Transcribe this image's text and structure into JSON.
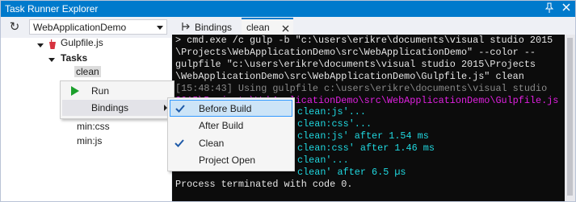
{
  "window": {
    "title": "Task Runner Explorer",
    "accent": "#007acc",
    "controls": [
      "pin",
      "close"
    ]
  },
  "toolbar": {
    "refresh_icon": "refresh-icon",
    "project_select": "WebApplicationDemo"
  },
  "tree": {
    "file": "Gulpfile.js",
    "tasks_label": "Tasks",
    "selected_task": "clean",
    "tasks_after": [
      "min:css",
      "min:js"
    ]
  },
  "context_menu": {
    "items": [
      {
        "label": "Run",
        "icon": "play-icon"
      },
      {
        "label": "Bindings",
        "icon": "",
        "submenu": true
      }
    ]
  },
  "bindings_submenu": {
    "items": [
      {
        "label": "Before Build",
        "checked": true,
        "highlighted": true
      },
      {
        "label": "After Build",
        "checked": false
      },
      {
        "label": "Clean",
        "checked": true
      },
      {
        "label": "Project Open",
        "checked": false
      }
    ]
  },
  "tabs": [
    {
      "label": "Bindings",
      "icon": "bindings-icon",
      "active": false
    },
    {
      "label": "clean",
      "icon": "",
      "active": true,
      "closable": true
    }
  ],
  "console": {
    "lines": [
      "> cmd.exe /c gulp -b \"c:\\users\\erikre\\documents\\visual studio 2015",
      "\\Projects\\WebApplicationDemo\\src\\WebApplicationDemo\" --color --",
      "gulpfile \"c:\\users\\erikre\\documents\\visual studio 2015\\Projects",
      "\\WebApplicationDemo\\src\\WebApplicationDemo\\Gulpfile.js\" clean",
      "[15:48:43] Using gulpfile c:\\users\\erikre\\documents\\visual studio",
      "2015\\Projects\\WebApplicationDemo\\src\\WebApplicationDemo\\Gulpfile.js",
      "clean:js'...",
      "clean:css'...",
      "clean:js' after 1.54 ms",
      "clean:css' after 1.46 ms",
      "clean'...",
      "clean' after 6.5 µs",
      "Process terminated with code 0."
    ]
  }
}
